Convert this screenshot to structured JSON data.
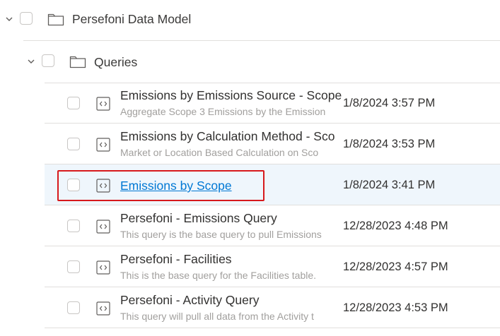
{
  "tree": {
    "root_folder": {
      "label": "Persefoni Data Model",
      "icon": "folder-icon",
      "expanded": true
    },
    "sub_folder": {
      "label": "Queries",
      "icon": "folder-icon",
      "expanded": true
    },
    "queries": [
      {
        "title": "Emissions by Emissions Source - Scope",
        "description": "Aggregate Scope 3 Emissions by the Emission",
        "modified": "1/8/2024 3:57 PM",
        "icon": "query-code-icon"
      },
      {
        "title": "Emissions by Calculation Method - Sco",
        "description": "Market or Location Based Calculation on Sco",
        "modified": "1/8/2024 3:53 PM",
        "icon": "query-code-icon"
      },
      {
        "title": "Emissions by Scope",
        "description": "",
        "modified": "1/8/2024 3:41 PM",
        "icon": "query-code-icon",
        "selected": true,
        "link": true
      },
      {
        "title": "Persefoni - Emissions Query",
        "description": "This query is the base query to pull Emissions",
        "modified": "12/28/2023 4:48 PM",
        "icon": "query-code-icon"
      },
      {
        "title": "Persefoni - Facilities",
        "description": "This is the base query for the Facilities table.",
        "modified": "12/28/2023 4:57 PM",
        "icon": "query-code-icon"
      },
      {
        "title": "Persefoni - Activity Query",
        "description": "This query will pull all data from the Activity t",
        "modified": "12/28/2023 4:53 PM",
        "icon": "query-code-icon"
      }
    ]
  },
  "colors": {
    "link": "#0078d4",
    "selected_row": "#eff6fc",
    "highlight_box": "#d7191c",
    "divider": "#e1dfdd"
  }
}
